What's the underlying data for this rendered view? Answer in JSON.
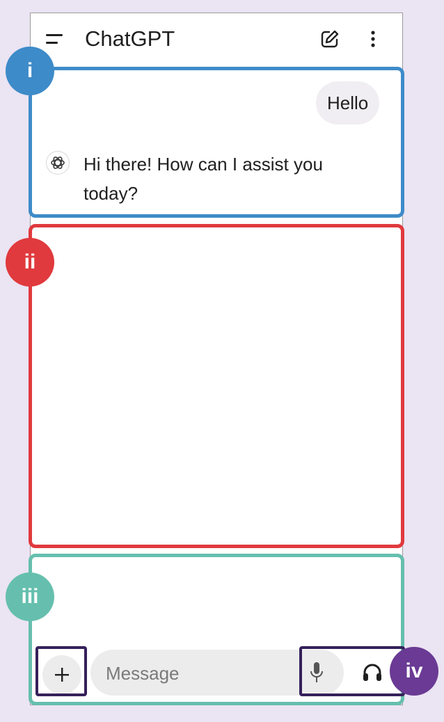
{
  "header": {
    "title": "ChatGPT",
    "menu_icon": "menu-icon",
    "edit_icon": "new-chat-icon",
    "more_icon": "more-vertical-icon"
  },
  "conversation": {
    "user_message": "Hello",
    "assistant_message": "Hi there! How can I assist you today?",
    "assistant_avatar_icon": "openai-logo-icon"
  },
  "composer": {
    "plus_icon": "plus-icon",
    "placeholder": "Message",
    "mic_icon": "microphone-icon",
    "voice_icon": "headphones-icon"
  },
  "annotations": {
    "labels": [
      "i",
      "ii",
      "iii",
      "iv"
    ],
    "colors": {
      "i": "#3d8bc9",
      "ii": "#e03a3e",
      "iii": "#66bfae",
      "iv": "#6a3a94"
    }
  },
  "colors": {
    "background": "#ebe4f3",
    "bubble": "#f0eef2",
    "input": "#ececec"
  }
}
